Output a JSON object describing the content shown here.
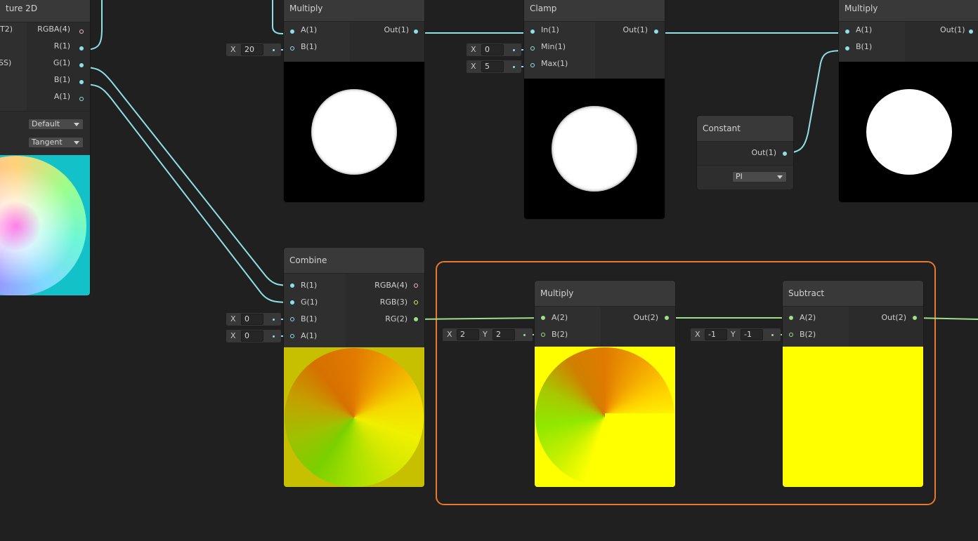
{
  "nodes": {
    "sample_texture": {
      "title": "ture 2D",
      "ports_in": [
        "T2)",
        "SS)"
      ],
      "ports_out": [
        "RGBA(4)",
        "R(1)",
        "G(1)",
        "B(1)",
        "A(1)"
      ],
      "dropdown_type": "Default",
      "dropdown_space": "Tangent"
    },
    "multiply1": {
      "title": "Multiply",
      "in": [
        "A(1)",
        "B(1)"
      ],
      "out": [
        "Out(1)"
      ],
      "field_b": {
        "label": "X",
        "value": "20"
      }
    },
    "clamp": {
      "title": "Clamp",
      "in": [
        "In(1)",
        "Min(1)",
        "Max(1)"
      ],
      "out": [
        "Out(1)"
      ],
      "field_min": {
        "label": "X",
        "value": "0"
      },
      "field_max": {
        "label": "X",
        "value": "5"
      }
    },
    "constant": {
      "title": "Constant",
      "out": [
        "Out(1)"
      ],
      "dropdown": "PI"
    },
    "multiply3": {
      "title": "Multiply",
      "in": [
        "A(1)",
        "B(1)"
      ],
      "out": [
        "Out(1)"
      ]
    },
    "combine": {
      "title": "Combine",
      "in": [
        "R(1)",
        "G(1)",
        "B(1)",
        "A(1)"
      ],
      "out": [
        "RGBA(4)",
        "RGB(3)",
        "RG(2)"
      ],
      "field_b": {
        "label": "X",
        "value": "0"
      },
      "field_a": {
        "label": "X",
        "value": "0"
      }
    },
    "multiply2": {
      "title": "Multiply",
      "in": [
        "A(2)",
        "B(2)"
      ],
      "out": [
        "Out(2)"
      ],
      "field_b": {
        "label_x": "X",
        "x": "2",
        "label_y": "Y",
        "y": "2"
      }
    },
    "subtract": {
      "title": "Subtract",
      "in": [
        "A(2)",
        "B(2)"
      ],
      "out": [
        "Out(2)"
      ],
      "field_b": {
        "label_x": "X",
        "x": "-1",
        "label_y": "Y",
        "y": "-1"
      }
    }
  },
  "colors": {
    "wire_float": "#8fe0e6",
    "wire_vec2": "#9ee08a",
    "group_outline": "#e9782d",
    "canvas_bg": "#202020",
    "preview_yellow": "#ffff00"
  }
}
